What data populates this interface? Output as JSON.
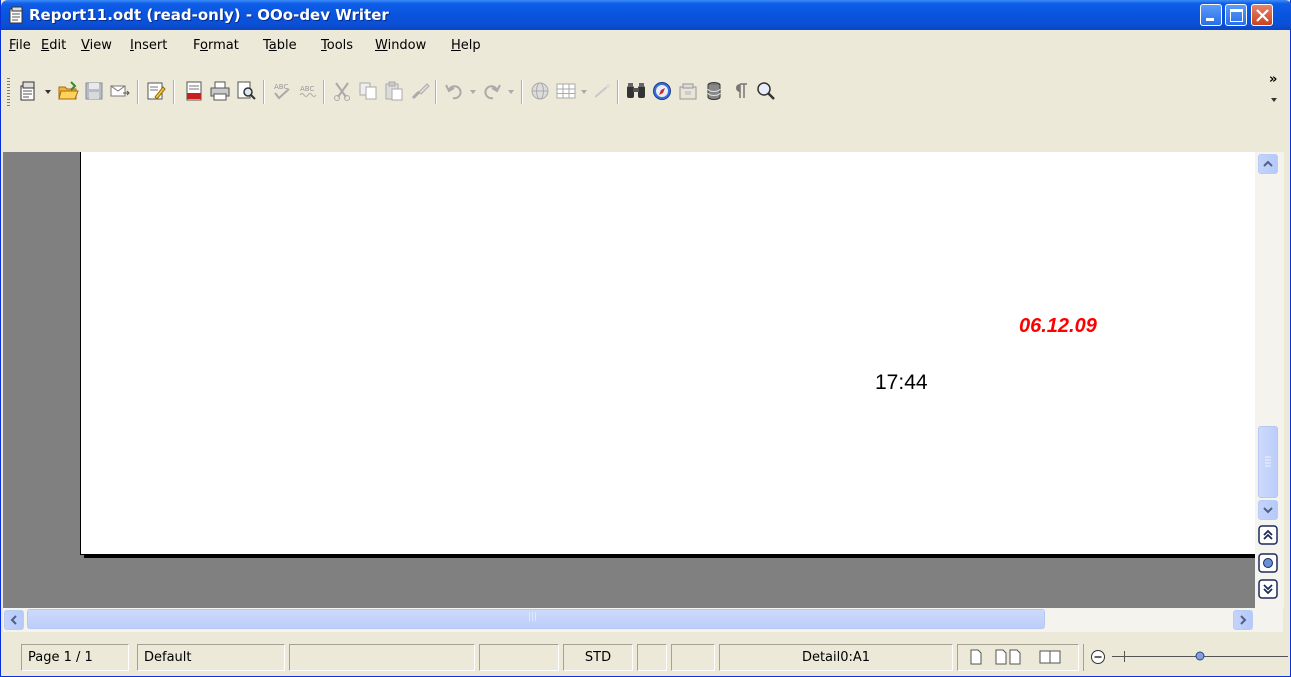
{
  "window": {
    "title": "Report11.odt (read-only) - OOo-dev Writer"
  },
  "menu": [
    {
      "label": "File",
      "accel": "F",
      "rest": "ile"
    },
    {
      "label": "Edit",
      "accel": "E",
      "rest": "dit"
    },
    {
      "label": "View",
      "accel": "V",
      "rest": "iew"
    },
    {
      "label": "Insert",
      "accel": "I",
      "rest": "nsert"
    },
    {
      "label": "Format",
      "pre": "F",
      "accel": "o",
      "rest": "rmat"
    },
    {
      "label": "Table",
      "pre": "T",
      "accel": "a",
      "rest": "ble"
    },
    {
      "label": "Tools",
      "accel": "T",
      "rest": "ools"
    },
    {
      "label": "Window",
      "accel": "W",
      "rest": "indow"
    },
    {
      "label": "Help",
      "accel": "H",
      "rest": "elp"
    }
  ],
  "toolbar": {
    "icons": [
      "new-document-icon",
      "open-folder-icon",
      "save-icon",
      "email-icon",
      "edit-file-icon",
      "export-pdf-icon",
      "print-icon",
      "page-preview-icon",
      "spellcheck-icon",
      "autospellcheck-icon",
      "cut-icon",
      "copy-icon",
      "paste-icon",
      "clone-format-icon",
      "undo-icon",
      "redo-icon",
      "hyperlink-icon",
      "table-icon",
      "draw-functions-icon",
      "find-replace-icon",
      "navigator-icon",
      "gallery-icon",
      "data-sources-icon",
      "formatting-marks-icon",
      "zoom-icon"
    ],
    "overflow": "»"
  },
  "document": {
    "date_field": "06.12.09",
    "time_field": "17:44",
    "date_color": "#ff0000"
  },
  "scrollbar": {
    "h_center_grip": "|||"
  },
  "status": {
    "page": "Page 1 / 1",
    "style": "Default",
    "language": "",
    "insert_mode": "",
    "selection_mode": "STD",
    "hyperlink_mode": "",
    "modified": "",
    "cell": "Detail0:A1"
  }
}
